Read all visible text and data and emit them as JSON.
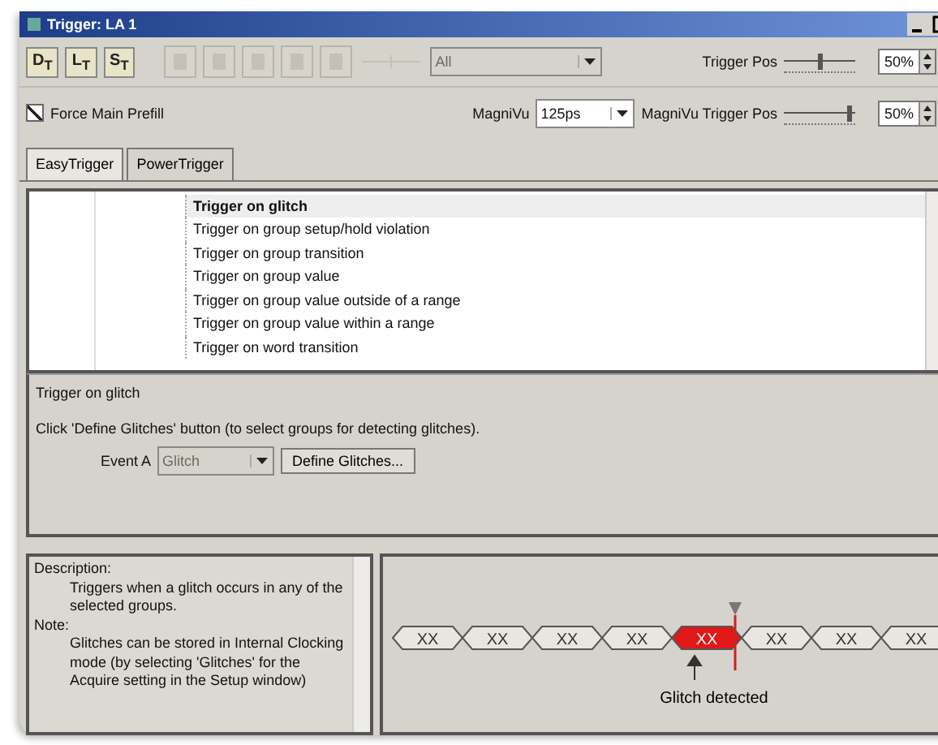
{
  "window": {
    "title": "Trigger: LA 1"
  },
  "toolbar": {
    "buttons": [
      {
        "label": "D$_{T}$",
        "disabled": false
      },
      {
        "label": "L$_{T}$",
        "disabled": false
      },
      {
        "label": "S$_{T}$",
        "disabled": false
      }
    ],
    "icon_buttons": [
      {
        "disabled": true
      },
      {
        "disabled": true
      },
      {
        "disabled": true
      },
      {
        "disabled": true
      },
      {
        "disabled": true
      }
    ],
    "storage_combo": {
      "value": "All",
      "disabled": true
    },
    "trigger_pos": {
      "label": "Trigger Pos",
      "level": 0.5,
      "value": "50%"
    }
  },
  "options": {
    "force_main_prefill": {
      "label": "Force Main Prefill",
      "checked": true
    },
    "magnivu": {
      "label": "MagniVu",
      "value": "125ps"
    },
    "magnivu_trigger_pos": {
      "label": "MagniVu Trigger Pos",
      "level": 0.9,
      "value": "50%"
    }
  },
  "tabs": [
    {
      "label": "EasyTrigger",
      "selected": true
    },
    {
      "label": "PowerTrigger",
      "selected": false
    }
  ],
  "trigger_list": [
    {
      "label": "Trigger on glitch",
      "selected": true
    },
    {
      "label": "Trigger on group setup/hold violation",
      "selected": false
    },
    {
      "label": "Trigger on group transition",
      "selected": false
    },
    {
      "label": "Trigger on group value",
      "selected": false
    },
    {
      "label": "Trigger on group value outside of a range",
      "selected": false
    },
    {
      "label": "Trigger on group value within a range",
      "selected": false
    },
    {
      "label": "Trigger on word transition",
      "selected": false
    }
  ],
  "settings": {
    "title": "Trigger on glitch",
    "instruction": "Click 'Define Glitches' button (to select groups for detecting glitches).",
    "event_label": "Event A",
    "event_combo": {
      "value": "Glitch",
      "disabled": true
    },
    "define_button": "Define Glitches..."
  },
  "description": [
    {
      "kind": "heading",
      "text": "Description:"
    },
    {
      "kind": "body",
      "text": "Triggers when a glitch occurs in any of the selected groups."
    },
    {
      "kind": "heading",
      "text": "Note:"
    },
    {
      "kind": "body",
      "text": "Glitches can be stored in Internal Clocking mode (by selecting 'Glitches' for the Acquire setting in the Setup window)"
    }
  ],
  "diagram": {
    "segments": [
      {
        "label": "XX",
        "kind": "normal"
      },
      {
        "label": "XX",
        "kind": "normal"
      },
      {
        "label": "XX",
        "kind": "normal"
      },
      {
        "label": "XX",
        "kind": "normal"
      },
      {
        "label": "XX",
        "kind": "glitch"
      },
      {
        "label": "XX",
        "kind": "normal"
      },
      {
        "label": "XX",
        "kind": "normal"
      },
      {
        "label": "XX",
        "kind": "normal"
      }
    ],
    "caption": "Glitch detected"
  }
}
